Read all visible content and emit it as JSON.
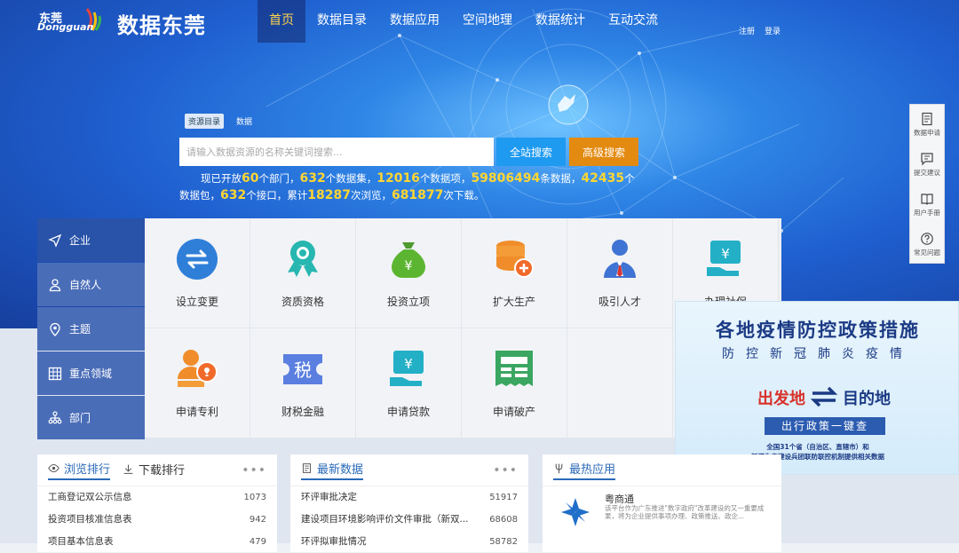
{
  "header": {
    "logo_cn": "东莞",
    "logo_en": "Dongguan",
    "site_title": "数据东莞",
    "nav": [
      {
        "label": "首页",
        "active": true
      },
      {
        "label": "数据目录"
      },
      {
        "label": "数据应用"
      },
      {
        "label": "空间地理"
      },
      {
        "label": "数据统计"
      },
      {
        "label": "互动交流"
      }
    ],
    "register": "注册",
    "login": "登录"
  },
  "search": {
    "tabs": [
      "资源目录",
      "数据"
    ],
    "placeholder": "请输入数据资源的名称关键词搜索...",
    "btn_all": "全站搜索",
    "btn_advanced": "高级搜索"
  },
  "stats": {
    "t1": "现已开放",
    "v1": "60",
    "t2": "个部门，",
    "v2": "632",
    "t3": "个数据集，",
    "v3": "12016",
    "t4": "个数据项，",
    "v4": "59806494",
    "t5": "条数据，",
    "v5": "42435",
    "t6": "个数据包，",
    "v6": "632",
    "t7": "个接口，累计",
    "v7": "18287",
    "t8": "次浏览，",
    "v8": "681877",
    "t9": "次下载。"
  },
  "side_tools": [
    {
      "label": "数据申请",
      "icon": "document-icon"
    },
    {
      "label": "提交建议",
      "icon": "message-icon"
    },
    {
      "label": "用户手册",
      "icon": "book-icon"
    },
    {
      "label": "常见问题",
      "icon": "question-icon"
    }
  ],
  "categories": [
    {
      "label": "企业",
      "icon": "navigation-icon",
      "active": true
    },
    {
      "label": "自然人",
      "icon": "person-icon"
    },
    {
      "label": "主题",
      "icon": "map-pin-icon"
    },
    {
      "label": "重点领域",
      "icon": "grid-icon"
    },
    {
      "label": "部门",
      "icon": "org-chart-icon"
    }
  ],
  "services": [
    {
      "label": "设立变更",
      "icon": "exchange-icon"
    },
    {
      "label": "资质资格",
      "icon": "certificate-icon"
    },
    {
      "label": "投资立项",
      "icon": "money-bag-icon"
    },
    {
      "label": "扩大生产",
      "icon": "database-add-icon"
    },
    {
      "label": "吸引人才",
      "icon": "talent-icon"
    },
    {
      "label": "办理社保",
      "icon": "social-security-icon"
    },
    {
      "label": "申请专利",
      "icon": "patent-icon"
    },
    {
      "label": "财税金融",
      "icon": "tax-icon"
    },
    {
      "label": "申请贷款",
      "icon": "loan-icon"
    },
    {
      "label": "申请破产",
      "icon": "bankruptcy-icon"
    }
  ],
  "banner": {
    "title": "各地疫情防控政策措施",
    "subtitle": "防控新冠肺炎疫情",
    "from": "出发地",
    "to": "目的地",
    "query": "出行政策一键查",
    "line1": "全国31个省（自治区、直辖市）和",
    "line2": "新疆生产建设兵团联防联控机制提供相关数据"
  },
  "ranking": {
    "tab_browse": "浏览排行",
    "tab_download": "下载排行",
    "more": "•••",
    "rows": [
      {
        "name": "工商登记双公示信息",
        "count": "1073"
      },
      {
        "name": "投资项目核准信息表",
        "count": "942"
      },
      {
        "name": "项目基本信息表",
        "count": "479"
      }
    ]
  },
  "latest": {
    "title": "最新数据",
    "more": "•••",
    "rows": [
      {
        "name": "环评审批决定",
        "count": "51917"
      },
      {
        "name": "建设项目环境影响评价文件审批（新双...",
        "count": "68608"
      },
      {
        "name": "环评拟审批情况",
        "count": "58782"
      }
    ]
  },
  "hot_apps": {
    "title": "最热应用",
    "app_name": "粤商通",
    "app_desc": "该平台作为广东推进\"数字政府\"改革建设的又一重要成果，将为企业提供事项办理、政策推送、政企..."
  },
  "colors": {
    "nav_active": "#ffd34d",
    "highlight": "#ffd631",
    "primary_blue": "#1e9af0",
    "orange": "#e38a10",
    "sidebar": "#4a6db8"
  }
}
